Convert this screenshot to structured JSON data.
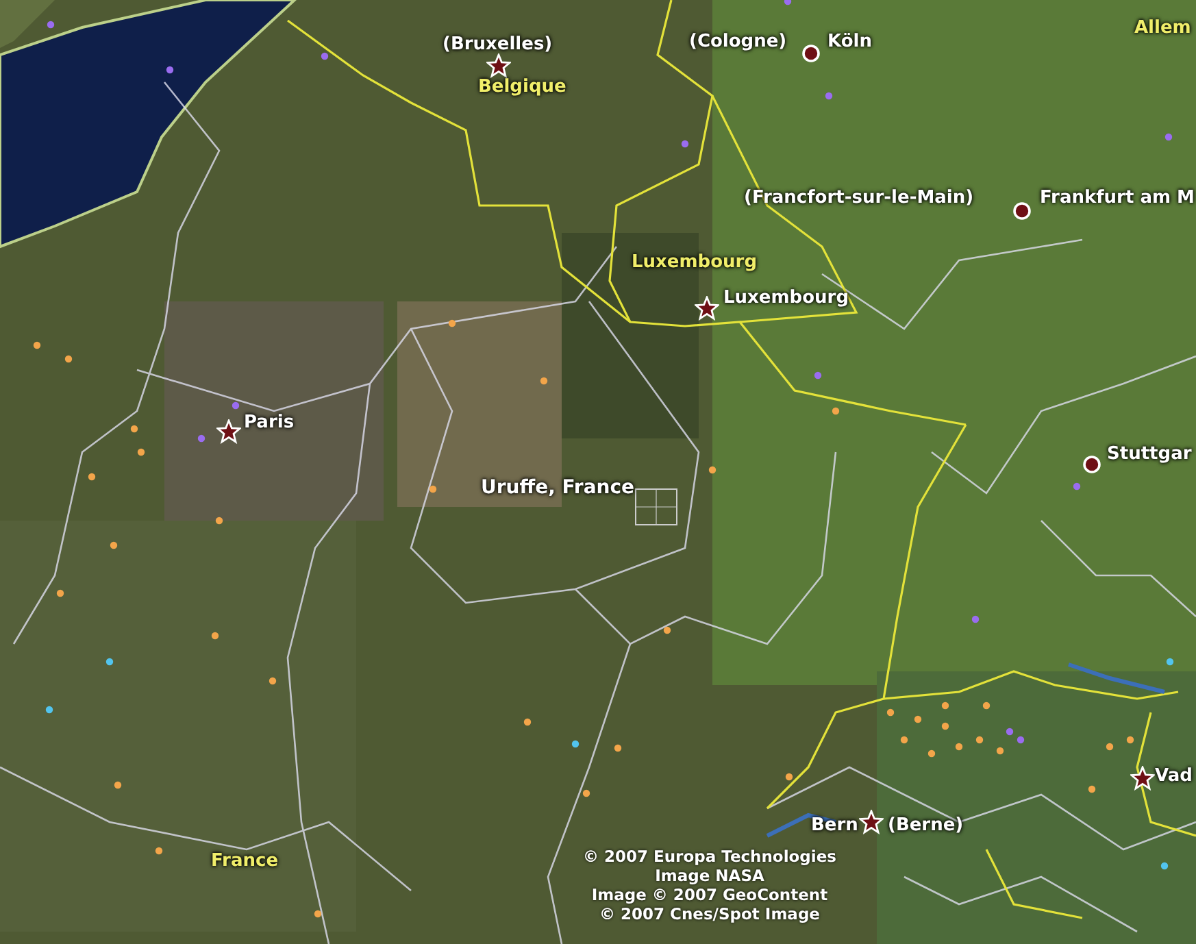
{
  "map": {
    "labels": [
      {
        "text": "(Bruxelles)",
        "kind": "city"
      },
      {
        "text": "Belgique",
        "kind": "country"
      },
      {
        "text": "(Cologne)",
        "kind": "city"
      },
      {
        "text": "Köln",
        "kind": "city"
      },
      {
        "text": "Allem",
        "kind": "country"
      },
      {
        "text": "(Francfort-sur-le-Main)",
        "kind": "city"
      },
      {
        "text": "Frankfurt am M",
        "kind": "city"
      },
      {
        "text": "Luxembourg",
        "kind": "country"
      },
      {
        "text": "Luxembourg",
        "kind": "city"
      },
      {
        "text": "Paris",
        "kind": "city"
      },
      {
        "text": "Uruffe, France",
        "kind": "search"
      },
      {
        "text": "Stuttgar",
        "kind": "city"
      },
      {
        "text": "Bern",
        "kind": "city"
      },
      {
        "text": "(Berne)",
        "kind": "city"
      },
      {
        "text": "Vad",
        "kind": "city"
      },
      {
        "text": "France",
        "kind": "country"
      }
    ],
    "markers": [
      {
        "kind": "capital"
      },
      {
        "kind": "city"
      },
      {
        "kind": "city"
      },
      {
        "kind": "capital"
      },
      {
        "kind": "capital"
      },
      {
        "kind": "search"
      },
      {
        "kind": "city"
      },
      {
        "kind": "capital"
      },
      {
        "kind": "capital"
      }
    ]
  },
  "attribution": [
    "© 2007 Europa Technologies",
    "Image NASA",
    "Image © 2007 GeoContent",
    "© 2007 Cnes/Spot Image"
  ]
}
